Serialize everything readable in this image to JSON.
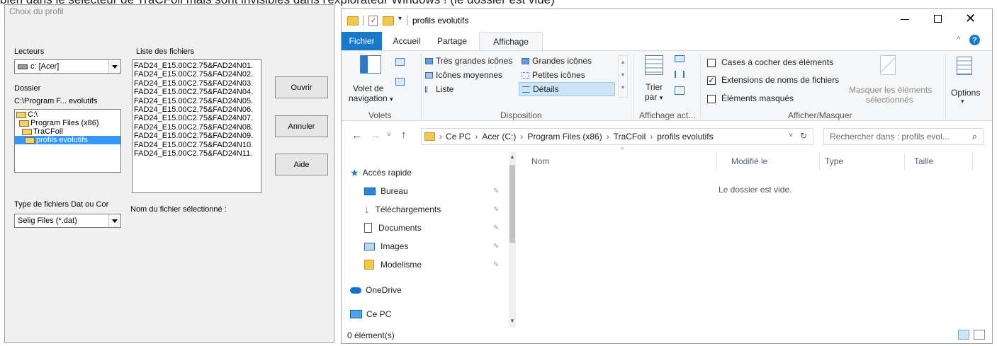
{
  "banner": "bien dans le sélecteur de TraCFoil mais sont invisibles dans l'explorateur Windows ! (le dossier est vide)",
  "dialog": {
    "title": "Choix du profil",
    "drives_label": "Lecteurs",
    "drive_value": "c: [Acer]",
    "folder_label": "Dossier",
    "folder_path": "C:\\Program F... evolutifs",
    "tree": [
      "C:\\",
      "Program Files (x86)",
      "TraCFoil",
      "profils evolutifs"
    ],
    "files_label": "Liste des fichiers",
    "files": [
      "FAD24_E15.00C2.75&FAD24N01.",
      "FAD24_E15.00C2.75&FAD24N02.",
      "FAD24_E15.00C2.75&FAD24N03.",
      "FAD24_E15.00C2.75&FAD24N04.",
      "FAD24_E15.00C2.75&FAD24N05.",
      "FAD24_E15.00C2.75&FAD24N06.",
      "FAD24_E15.00C2.75&FAD24N07.",
      "FAD24_E15.00C2.75&FAD24N08.",
      "FAD24_E15.00C2.75&FAD24N09.",
      "FAD24_E15.00C2.75&FAD24N10.",
      "FAD24_E15.00C2.75&FAD24N11."
    ],
    "open_button": "Ouvrir",
    "cancel_button": "Annuler",
    "help_button": "Aide",
    "filetype_label": "Type de fichiers Dat ou Cor",
    "filetype_value": "Selig Files (*.dat)",
    "selected_file_label": "Nom du fichier sélectionné :"
  },
  "explorer": {
    "window_title": "profils evolutifs",
    "tabs": [
      "Fichier",
      "Accueil",
      "Partage",
      "Affichage"
    ],
    "ribbon": {
      "nav_pane_line1": "Volet de",
      "nav_pane_line2": "navigation",
      "group_volets": "Volets",
      "layout_items": [
        "Très grandes icônes",
        "Grandes icônes",
        "Icônes moyennes",
        "Petites icônes",
        "Liste",
        "Détails"
      ],
      "group_disposition": "Disposition",
      "sort_line1": "Trier",
      "sort_line2": "par",
      "group_current_view": "Affichage act...",
      "chk_item_checkboxes": "Cases à cocher des éléments",
      "chk_file_extensions": "Extensions de noms de fichiers",
      "chk_hidden_items": "Éléments masqués",
      "hide_selected_line1": "Masquer les éléments",
      "hide_selected_line2": "sélectionnés",
      "group_show_hide": "Afficher/Masquer",
      "options": "Options"
    },
    "breadcrumb": [
      "Ce PC",
      "Acer (C:)",
      "Program Files (x86)",
      "TraCFoil",
      "profils evolutifs"
    ],
    "search_placeholder": "Rechercher dans : profils evol...",
    "nav": {
      "quick_access": "Accès rapide",
      "items": [
        "Bureau",
        "Téléchargements",
        "Documents",
        "Images",
        "Modelisme"
      ],
      "onedrive": "OneDrive",
      "this_pc": "Ce PC"
    },
    "columns": [
      "Nom",
      "Modifié le",
      "Type",
      "Taille"
    ],
    "empty_message": "Le dossier est vide.",
    "status_count": "0 élément(s)"
  }
}
